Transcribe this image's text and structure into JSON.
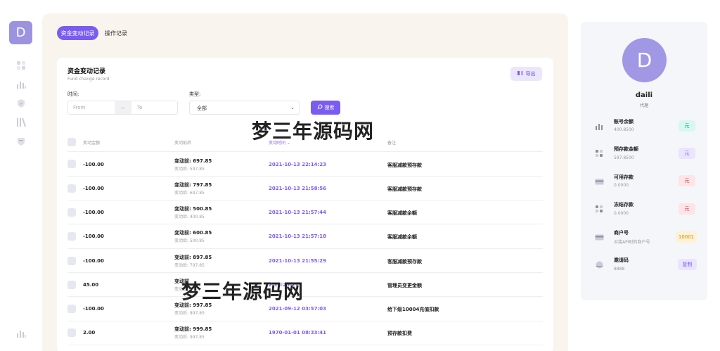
{
  "app": {
    "logo_letter": "D"
  },
  "tabs": [
    {
      "label": "资金变动记录",
      "active": true
    },
    {
      "label": "操作记录",
      "active": false
    }
  ],
  "panel": {
    "title": "资金变动记录",
    "subtitle": "Fund change record",
    "export_label": "导出"
  },
  "filters": {
    "time_label": "时间:",
    "from_placeholder": "From",
    "separator": "—",
    "to_placeholder": "To",
    "type_label": "类型:",
    "type_value": "全部",
    "search_label": "搜索"
  },
  "table": {
    "headers": [
      "变动金额",
      "变动前后",
      "变动时间",
      "备注"
    ],
    "rows": [
      {
        "amount": "-100.00",
        "before": "变动前: 697.85",
        "after": "变动后: 597.85",
        "time": "2021-10-13 22:14:23",
        "note": "客服减款预存款"
      },
      {
        "amount": "-100.00",
        "before": "变动前: 797.85",
        "after": "变动后: 697.85",
        "time": "2021-10-13 21:58:56",
        "note": "客服减款预存款"
      },
      {
        "amount": "-100.00",
        "before": "变动前: 500.85",
        "after": "变动后: 400.85",
        "time": "2021-10-13 21:57:44",
        "note": "客服减款余额"
      },
      {
        "amount": "-100.00",
        "before": "变动前: 600.85",
        "after": "变动后: 500.85",
        "time": "2021-10-13 21:57:18",
        "note": "客服减款余额"
      },
      {
        "amount": "-100.00",
        "before": "变动前: 897.85",
        "after": "变动后: 797.85",
        "time": "2021-10-13 21:55:29",
        "note": "客服减款预存款"
      },
      {
        "amount": "45.00",
        "before": "变动前",
        "after": "变动后",
        "time": "2:18:25:21",
        "note": "管理员变更金额"
      },
      {
        "amount": "-100.00",
        "before": "变动前: 997.85",
        "after": "变动后: 897.85",
        "time": "2021-09-12 03:57:03",
        "note": "给下级10004充值扣款"
      },
      {
        "amount": "2.00",
        "before": "变动前: 999.85",
        "after": "变动后: 997.85",
        "time": "1970-01-01 08:33:41",
        "note": "预存款扣费"
      }
    ]
  },
  "watermark": "梦三年源码网",
  "profile": {
    "avatar_letter": "D",
    "name": "daili",
    "role": "代理",
    "stats": [
      {
        "label": "账号余额",
        "value": "400.8500",
        "badge": "元",
        "icon": "bar-chart-icon",
        "badge_bg": "#d9f7f2",
        "badge_fg": "#1aa38a"
      },
      {
        "label": "预存款金额",
        "value": "597.8500",
        "badge": "元",
        "icon": "grid-icon",
        "badge_bg": "#ebe4fd",
        "badge_fg": "#7b5cf0"
      },
      {
        "label": "可用存款",
        "value": "0.0000",
        "badge": "元",
        "icon": "card-icon",
        "badge_bg": "#fde4e6",
        "badge_fg": "#e0404f"
      },
      {
        "label": "冻结存款",
        "value": "0.0000",
        "badge": "元",
        "icon": "grid-icon",
        "badge_bg": "#fde4e6",
        "badge_fg": "#e0404f"
      },
      {
        "label": "商户号",
        "value": "对接API时的商户号",
        "badge": "10001",
        "icon": "card-icon",
        "badge_bg": "#fdf1d8",
        "badge_fg": "#d68f00"
      },
      {
        "label": "邀请码",
        "value": "8888",
        "badge": "复制",
        "icon": "globe-icon",
        "badge_bg": "#ebe4fd",
        "badge_fg": "#7b5cf0"
      }
    ]
  }
}
